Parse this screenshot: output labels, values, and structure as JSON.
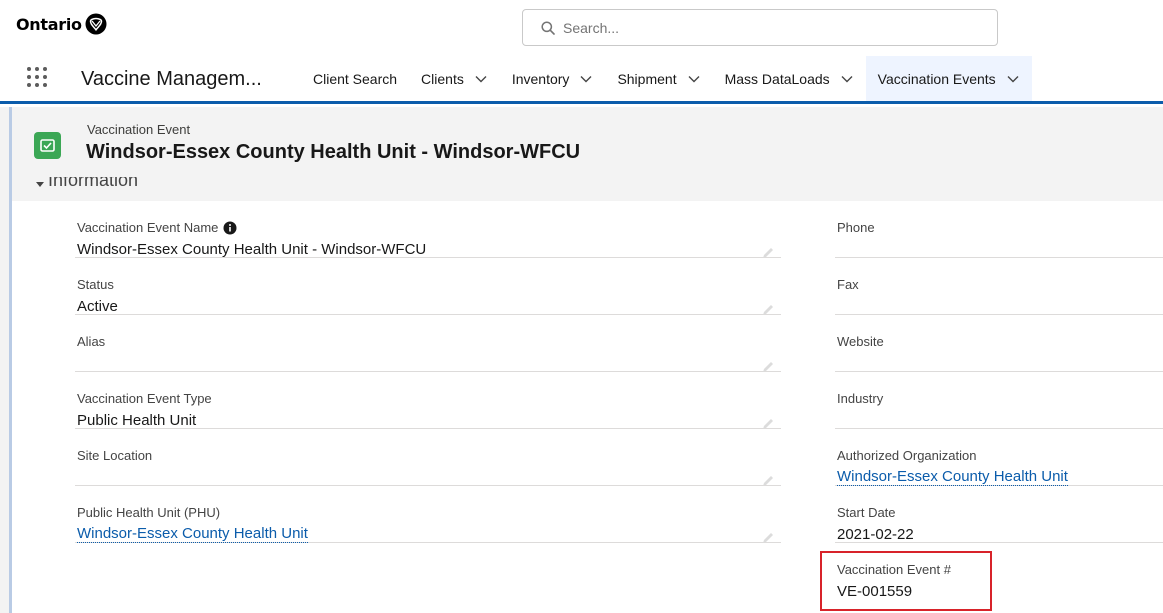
{
  "header": {
    "logo_text": "Ontario",
    "search_placeholder": "Search..."
  },
  "nav": {
    "app_name": "Vaccine Managem...",
    "items": [
      {
        "label": "Client Search"
      },
      {
        "label": "Clients"
      },
      {
        "label": "Inventory"
      },
      {
        "label": "Shipment"
      },
      {
        "label": "Mass DataLoads"
      },
      {
        "label": "Vaccination Events"
      }
    ],
    "active_item": "Vaccination Events"
  },
  "record": {
    "object_label": "Vaccination Event",
    "title": "Windsor-Essex County Health Unit - Windsor-WFCU",
    "section_title": "Information"
  },
  "fields_left": [
    {
      "label": "Vaccination Event Name",
      "value": "Windsor-Essex County Health Unit - Windsor-WFCU",
      "has_info_icon": true
    },
    {
      "label": "Status",
      "value": "Active"
    },
    {
      "label": "Alias",
      "value": ""
    },
    {
      "label": "Vaccination Event Type",
      "value": "Public Health Unit"
    },
    {
      "label": "Site Location",
      "value": ""
    },
    {
      "label": "Public Health Unit (PHU)",
      "value": "Windsor-Essex County Health Unit",
      "is_link": true
    }
  ],
  "fields_right": [
    {
      "label": "Phone",
      "value": ""
    },
    {
      "label": "Fax",
      "value": ""
    },
    {
      "label": "Website",
      "value": ""
    },
    {
      "label": "Industry",
      "value": ""
    },
    {
      "label": "Authorized Organization",
      "value": "Windsor-Essex County Health Unit",
      "is_link": true
    },
    {
      "label": "Start Date",
      "value": "2021-02-22"
    },
    {
      "label": "Vaccination Event #",
      "value": "VE-001559",
      "highlighted": true
    }
  ],
  "colors": {
    "brand_blue": "#0b5cab",
    "object_icon_green": "#3ba755",
    "highlight_red": "#d8232a"
  },
  "icons": {
    "logo": "ontario-trillium-icon",
    "search": "search-icon",
    "app_launcher": "waffle-icon",
    "nav_dropdown": "chevron-down-icon",
    "object": "vaccination-event-icon",
    "edit": "pencil-icon",
    "info": "info-icon"
  }
}
